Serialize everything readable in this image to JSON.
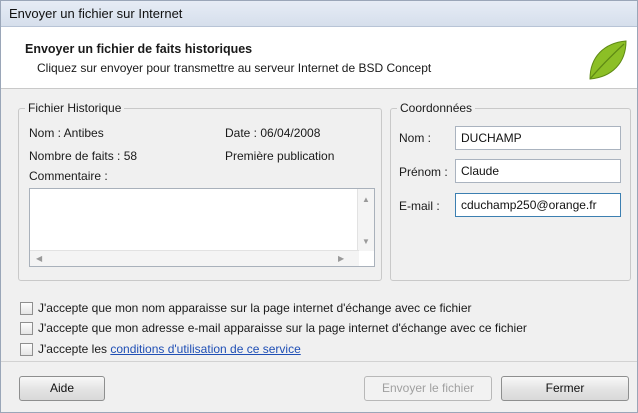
{
  "window": {
    "title": "Envoyer un fichier sur Internet"
  },
  "header": {
    "title": "Envoyer un fichier de faits historiques",
    "subtitle": "Cliquez sur envoyer pour transmettre au serveur Internet de BSD Concept",
    "leaf_color": "#8cbf26"
  },
  "file_group": {
    "label": "Fichier Historique",
    "name": "Nom : Antibes",
    "date": "Date : 06/04/2008",
    "facts_count": "Nombre de faits : 58",
    "status": "Première publication",
    "comment_label": "Commentaire :",
    "comment_value": ""
  },
  "contact_group": {
    "label": "Coordonnées",
    "nom_label": "Nom :",
    "nom_value": "DUCHAMP",
    "prenom_label": "Prénom :",
    "prenom_value": "Claude",
    "email_label": "E-mail :",
    "email_value": "cduchamp250@orange.fr"
  },
  "consents": {
    "name": "J'accepte que mon nom apparaisse sur la page internet d'échange avec ce fichier",
    "email": "J'accepte que mon adresse e-mail apparaisse sur la page internet d'échange avec ce fichier",
    "terms_prefix": "J'accepte les",
    "terms_link": "conditions d'utilisation de ce service"
  },
  "buttons": {
    "help": "Aide",
    "send": "Envoyer le fichier",
    "close": "Fermer"
  }
}
